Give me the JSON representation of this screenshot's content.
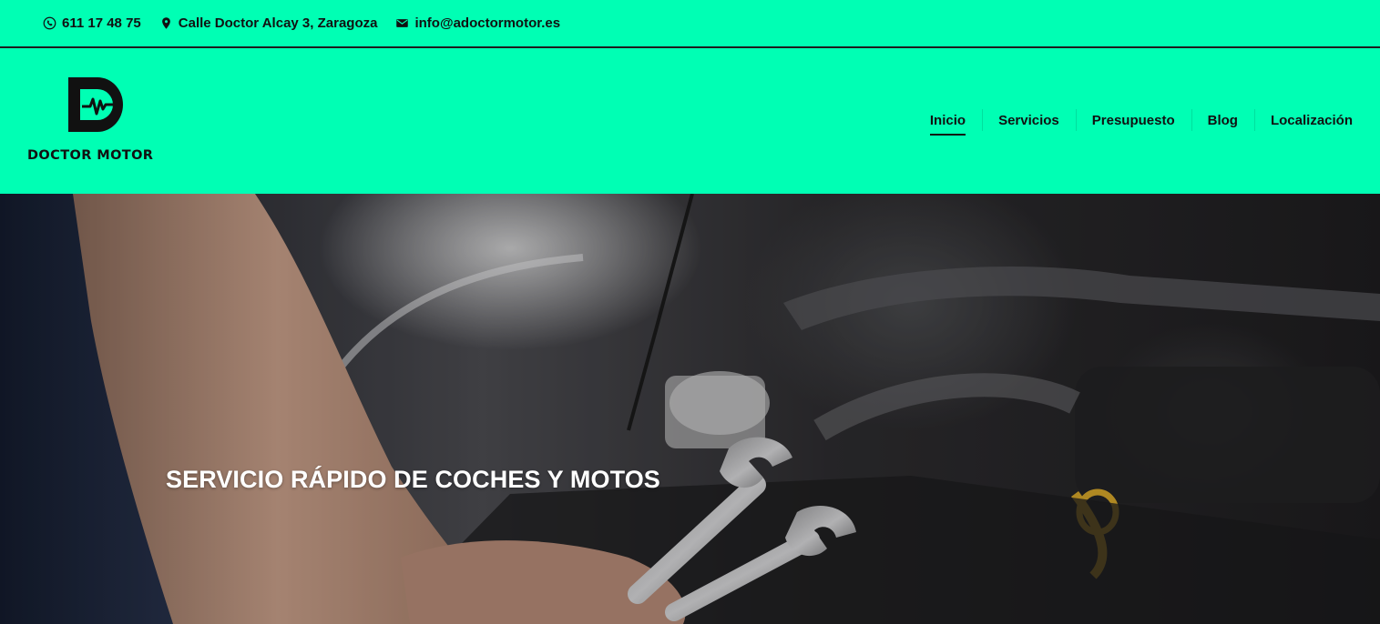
{
  "topbar": {
    "phone": "611 17 48 75",
    "address": "Calle Doctor Alcay 3, Zaragoza",
    "email": "info@adoctormotor.es"
  },
  "brand": {
    "logo_letter": "D",
    "name": "DOCTOR MOTOR"
  },
  "nav": {
    "items": [
      {
        "label": "Inicio",
        "active": true
      },
      {
        "label": "Servicios",
        "active": false
      },
      {
        "label": "Presupuesto",
        "active": false
      },
      {
        "label": "Blog",
        "active": false
      },
      {
        "label": "Localización",
        "active": false
      }
    ]
  },
  "hero": {
    "title": "SERVICIO RÁPIDO DE COCHES Y MOTOS"
  },
  "colors": {
    "accent": "#00ffb4",
    "text": "#111111",
    "hero_text": "#ffffff"
  }
}
